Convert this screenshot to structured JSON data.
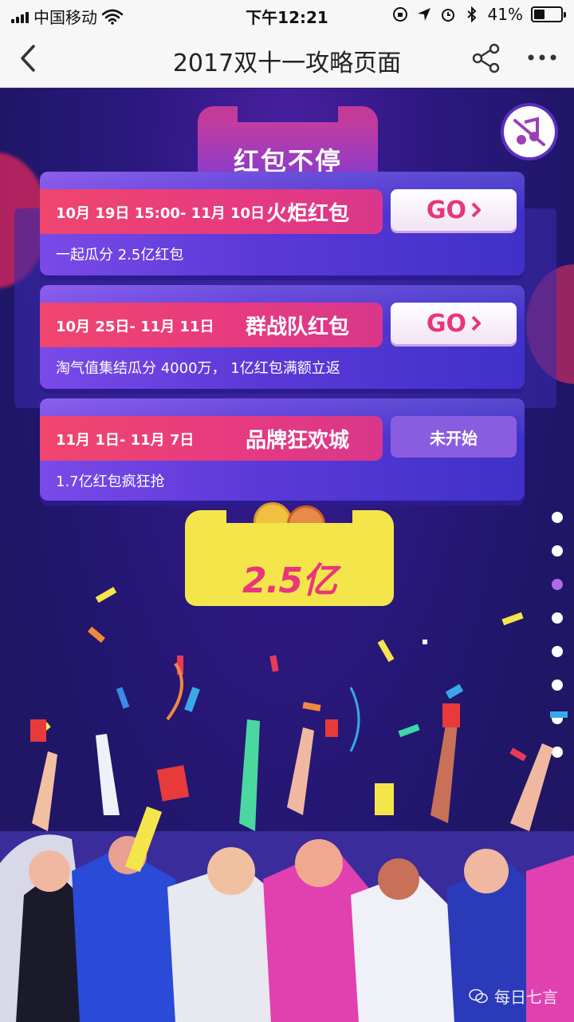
{
  "status_bar": {
    "carrier": "中国移动",
    "time": "下午12:21",
    "battery": "41%",
    "battery_level": 0.41
  },
  "nav": {
    "title": "2017双十一攻略页面"
  },
  "header": {
    "title": "红包不停"
  },
  "cards": [
    {
      "date": "10月 19日 15:00- 11月 10日",
      "name": "火炬红包",
      "desc": "一起瓜分 2.5亿红包",
      "button": "GO",
      "state": "active"
    },
    {
      "date": "10月 25日- 11月 11日",
      "name": "群战队红包",
      "desc": "淘气值集结瓜分 4000万， 1亿红包满额立返",
      "button": "GO",
      "state": "active"
    },
    {
      "date": "11月 1日- 11月 7日",
      "name": "品牌狂欢城",
      "desc": "1.7亿红包疯狂抢",
      "button": "未开始",
      "state": "disabled"
    }
  ],
  "badge": {
    "text": "2.5亿"
  },
  "pager": {
    "count": 8,
    "active_index": 2
  },
  "watermark": {
    "text": "每日七言"
  },
  "colors": {
    "accent_pink": "#e8367a",
    "card_purple": "#5b39d8",
    "badge_yellow": "#f4e64a"
  }
}
